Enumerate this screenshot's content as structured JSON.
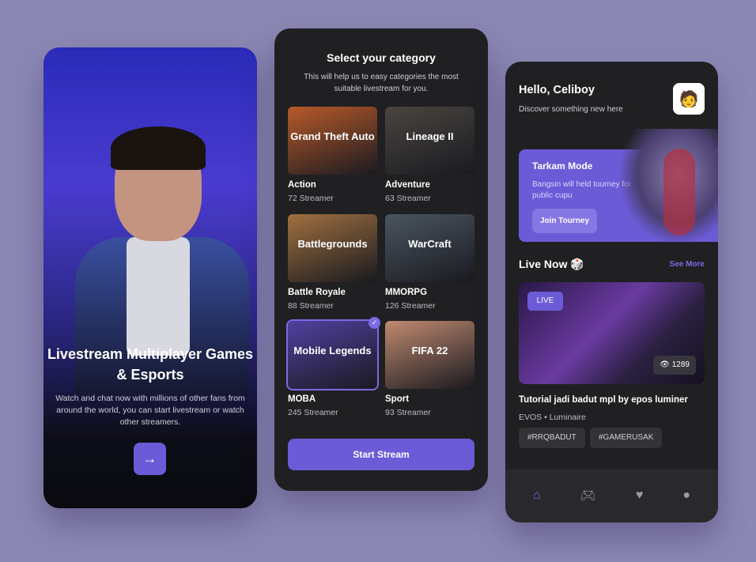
{
  "onboarding": {
    "title": "Livestream Multiplayer Games & Esports",
    "description": "Watch and chat now with millions of other fans from around the world, you can start livestream or watch other streamers.",
    "next_icon": "arrow-right-icon"
  },
  "category": {
    "title": "Select your category",
    "subtitle": "This will help us to easy categories the most suitable livestream for you.",
    "items": [
      {
        "name": "Action",
        "count": "72 Streamer",
        "art": "Grand Theft Auto",
        "color": "#b85a2a"
      },
      {
        "name": "Adventure",
        "count": "63 Streamer",
        "art": "Lineage II",
        "color": "#4a4540"
      },
      {
        "name": "Battle Royale",
        "count": "88 Streamer",
        "art": "Battlegrounds",
        "color": "#a07040"
      },
      {
        "name": "MMORPG",
        "count": "126 Streamer",
        "art": "WarCraft",
        "color": "#4a5560"
      },
      {
        "name": "MOBA",
        "count": "245 Streamer",
        "art": "Mobile Legends",
        "color": "#5040a0",
        "selected": true
      },
      {
        "name": "Sport",
        "count": "93 Streamer",
        "art": "FIFA 22",
        "color": "#c08a70"
      }
    ],
    "start_button": "Start Stream"
  },
  "home": {
    "greeting": "Hello, Celiboy",
    "subtitle": "Discover something new here",
    "promo": {
      "title": "Tarkam Mode",
      "description": "Bangsin will held tourney for public cupu",
      "button": "Join Tourney"
    },
    "live_header": "Live Now 🎲",
    "see_more": "See More",
    "stream": {
      "badge": "LIVE",
      "views": "👁 1289",
      "title": "Tutorial jadi badut mpl by epos luminer",
      "author": "EVOS • Luminaire",
      "tags": [
        "#RRQBADUT",
        "#GAMERUSAK"
      ]
    },
    "nav": [
      "home-icon",
      "gamepad-icon",
      "heart-icon",
      "profile-icon"
    ]
  }
}
